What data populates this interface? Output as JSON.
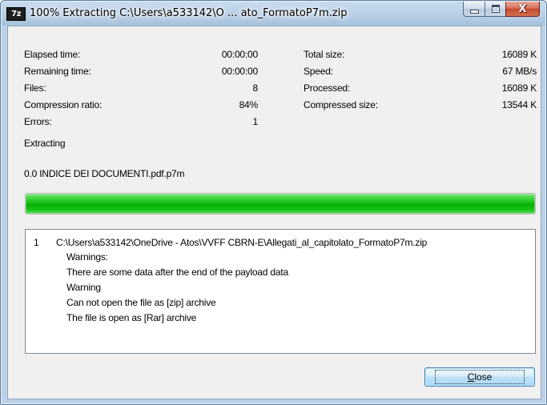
{
  "window": {
    "icon_text": "7z",
    "title": "100% Extracting C:\\Users\\a533142\\O ... ato_FormatoP7m.zip",
    "controls": {
      "minimize": "",
      "maximize": "",
      "close": "X"
    }
  },
  "stats": {
    "left": [
      {
        "label": "Elapsed time:",
        "value": "00:00:00"
      },
      {
        "label": "Remaining time:",
        "value": "00:00:00"
      },
      {
        "label": "Files:",
        "value": "8"
      },
      {
        "label": "Compression ratio:",
        "value": "84%"
      },
      {
        "label": "Errors:",
        "value": "1"
      }
    ],
    "right": [
      {
        "label": "Total size:",
        "value": "16089 K"
      },
      {
        "label": "Speed:",
        "value": "67 MB/s"
      },
      {
        "label": "Processed:",
        "value": "16089 K"
      },
      {
        "label": "Compressed size:",
        "value": "13544 K"
      }
    ]
  },
  "status": "Extracting",
  "current_file": "0.0 INDICE DEI DOCUMENTI.pdf.p7m",
  "progress": {
    "fraction": 1.0
  },
  "log": {
    "number": "1",
    "lines": [
      "C:\\Users\\a533142\\OneDrive - Atos\\VVFF CBRN-E\\Allegati_al_capitolato_FormatoP7m.zip",
      "Warnings:",
      "There are some data after the end of the payload data",
      "Warning",
      "Can not open the file as [zip] archive",
      "The file is open as [Rar] archive"
    ]
  },
  "buttons": {
    "close_first": "C",
    "close_rest": "lose"
  },
  "colors": {
    "progress_green": "#06b006",
    "close_button": "#c54a2f",
    "client_bg": "#f0f0f0"
  }
}
